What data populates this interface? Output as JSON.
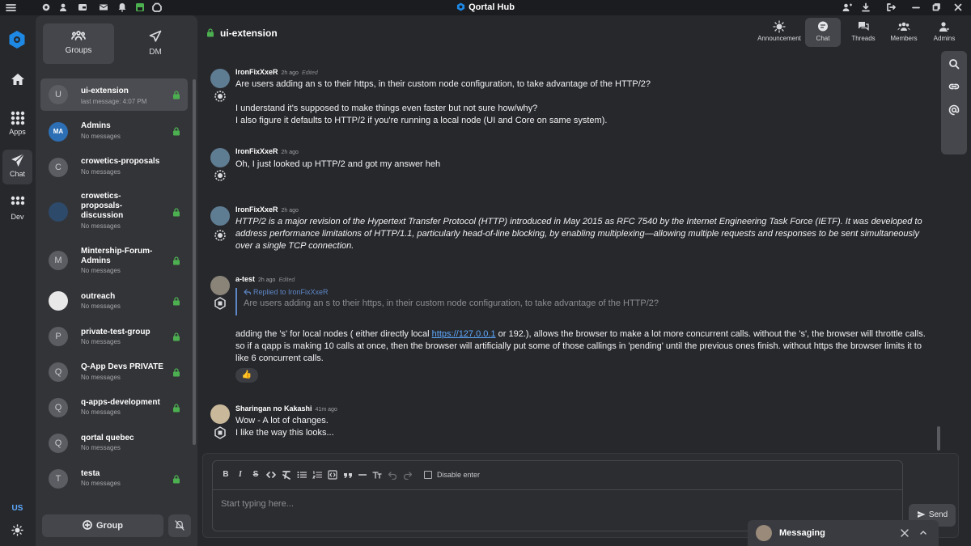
{
  "window": {
    "title": "Qortal Hub"
  },
  "rail": {
    "items": [
      {
        "label": "Apps"
      },
      {
        "label": "Chat"
      },
      {
        "label": "Dev"
      }
    ],
    "language": "US"
  },
  "panel": {
    "tabs": [
      {
        "label": "Groups"
      },
      {
        "label": "DM"
      }
    ],
    "groups": [
      {
        "name": "ui-extension",
        "sub": "last message: 4:07 PM",
        "avatar": "U",
        "locked": true
      },
      {
        "name": "Admins",
        "sub": "No messages",
        "avatar": "MA",
        "locked": true
      },
      {
        "name": "crowetics-proposals",
        "sub": "No messages",
        "avatar": "C",
        "locked": false
      },
      {
        "name": "crowetics-proposals-discussion",
        "sub": "No messages",
        "avatar": "",
        "locked": true
      },
      {
        "name": "Mintership-Forum-Admins",
        "sub": "No messages",
        "avatar": "M",
        "locked": true
      },
      {
        "name": "outreach",
        "sub": "No messages",
        "avatar": "",
        "locked": true
      },
      {
        "name": "private-test-group",
        "sub": "No messages",
        "avatar": "P",
        "locked": true
      },
      {
        "name": "Q-App Devs PRIVATE",
        "sub": "No messages",
        "avatar": "Q",
        "locked": true
      },
      {
        "name": "q-apps-development",
        "sub": "No messages",
        "avatar": "Q",
        "locked": true
      },
      {
        "name": "qortal quebec",
        "sub": "No messages",
        "avatar": "Q",
        "locked": false
      },
      {
        "name": "testa",
        "sub": "No messages",
        "avatar": "T",
        "locked": true
      }
    ],
    "group_button": "Group"
  },
  "header": {
    "channel": "ui-extension",
    "nav": [
      {
        "label": "Announcement"
      },
      {
        "label": "Chat"
      },
      {
        "label": "Threads"
      },
      {
        "label": "Members"
      },
      {
        "label": "Admins"
      }
    ]
  },
  "messages": [
    {
      "author": "IronFixXxeR",
      "time": "2h ago",
      "edited": "Edited",
      "lines": [
        "Are users adding an s to their https, in their custom node configuration, to take advantage of the HTTP/2?",
        "",
        "I understand it's supposed to make things even faster but not sure how/why?",
        "I also figure it defaults to HTTP/2 if you're running a local node (UI and Core on same system)."
      ]
    },
    {
      "author": "IronFixXxeR",
      "time": "2h ago",
      "lines": [
        "Oh, I just looked up HTTP/2 and got my answer heh"
      ]
    },
    {
      "author": "IronFixXxeR",
      "time": "2h ago",
      "italic": "HTTP/2 is a major revision of the Hypertext Transfer Protocol (HTTP) introduced in May 2015 as RFC 7540 by the Internet Engineering Task Force (IETF). It was developed to address performance limitations of HTTP/1.1, particularly head-of-line blocking, by enabling multiplexing—allowing multiple requests and responses to be sent simultaneously over a single TCP connection."
    },
    {
      "author": "a-test",
      "time": "2h ago",
      "edited": "Edited",
      "reply_to": "Replied to IronFixXxeR",
      "reply_quote": "Are users adding an s to their https, in their custom node configuration, to take advantage of the HTTP/2?",
      "body_pre": "adding the 's' for local nodes ( either directly local ",
      "link": "https://127.0.0.1",
      "body_post": " or 192.), allows the browser to make a lot more concurrent calls. without the 's', the browser will throttle calls. so if a qapp is making 10 calls at once, then the browser will artificially put some of those callings in 'pending' until the previous ones finish. without https the browser limits it to like 6 concurrent calls.",
      "reaction": "👍"
    },
    {
      "author": "Sharingan no Kakashi",
      "time": "41m ago",
      "lines": [
        "Wow - A lot of changes.",
        "I like the way this looks..."
      ]
    }
  ],
  "composer": {
    "disable_enter": "Disable enter",
    "placeholder": "Start typing here...",
    "send": "Send"
  },
  "messaging_popup": {
    "label": "Messaging"
  },
  "colors": {
    "accent": "#1e88e5",
    "lock": "#4caf50",
    "link": "#5ea9ff"
  }
}
